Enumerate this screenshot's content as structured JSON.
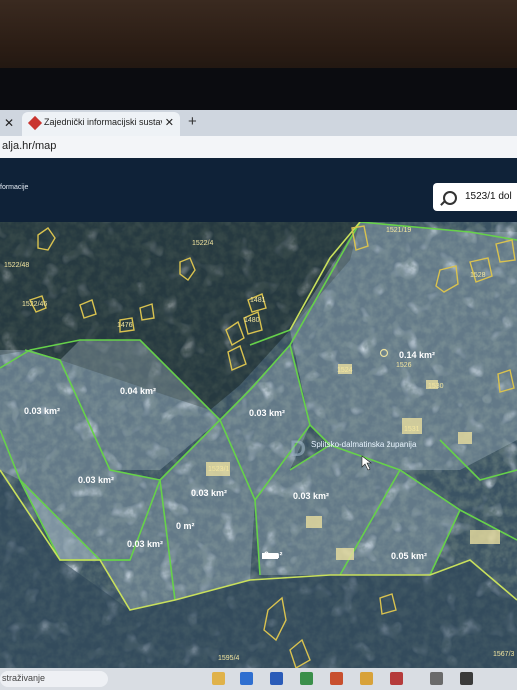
{
  "browser": {
    "tab_title": "Zajednički informacijski sustav ze",
    "url": "alja.hr/map"
  },
  "app": {
    "header_label": "formacije",
    "search_value": "1523/1 dol"
  },
  "map": {
    "region_label": "Splitsko-dalmatinska županija",
    "area_labels": [
      "0.14 km²",
      "0.04 km²",
      "0.03 km²",
      "0.03 km²",
      "0.03 km²",
      "0.03 km²",
      "0.03 km²",
      "0.03 km²",
      "0.05 km²",
      "0 m²",
      "0 m²"
    ],
    "parcel_labels": [
      "1522/4",
      "1522/48",
      "1522/46",
      "1476",
      "1481",
      "1480",
      "1528",
      "1524",
      "1526",
      "1530",
      "1531",
      "1523/1",
      "1521/19",
      "1595/4",
      "1567/3"
    ]
  },
  "taskbar": {
    "search_placeholder": "straživanje"
  }
}
